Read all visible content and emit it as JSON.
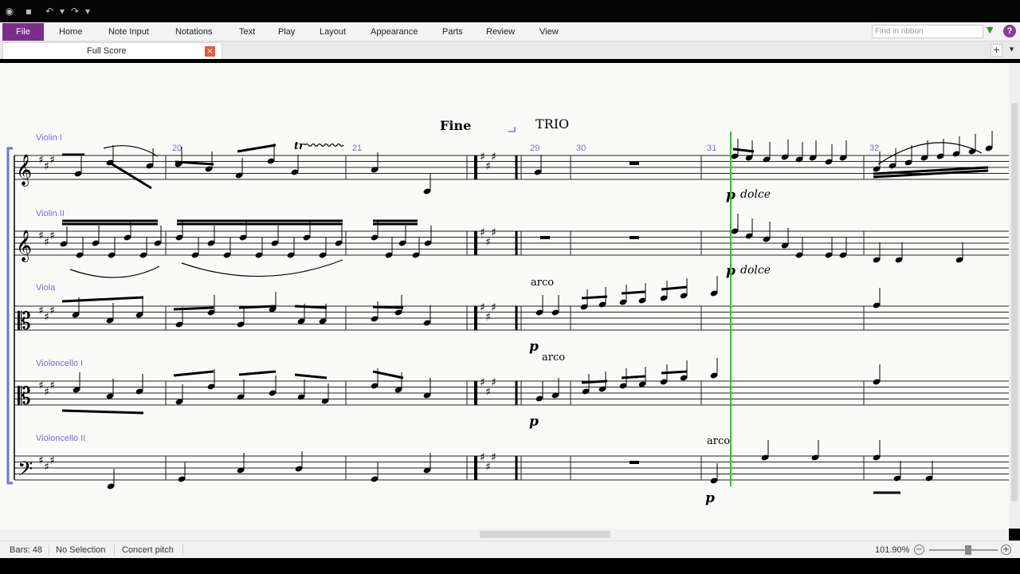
{
  "ribbon": {
    "file": "File",
    "tabs": [
      "Home",
      "Note Input",
      "Notations",
      "Text",
      "Play",
      "Layout",
      "Appearance",
      "Parts",
      "Review",
      "View"
    ],
    "find_placeholder": "Find in ribbon",
    "help": "?"
  },
  "document_tab": {
    "label": "Full Score",
    "close": "×"
  },
  "tabbar_buttons": {
    "add": "+",
    "menu": "▾"
  },
  "score": {
    "instruments": [
      "Violin I",
      "Violin II",
      "Viola",
      "Violoncello I",
      "Violoncello II"
    ],
    "bar_numbers": [
      "20",
      "21",
      "29",
      "30",
      "31",
      "32"
    ],
    "text": {
      "fine": "Fine",
      "trio": "TRIO",
      "trill": "tr",
      "arco": "arco",
      "dolce": "dolce",
      "dynamic_p": "p"
    }
  },
  "status": {
    "bars": "Bars: 48",
    "selection": "No Selection",
    "pitch": "Concert pitch",
    "zoom": "101.90%"
  },
  "icons": {
    "app": "app-icon",
    "save": "save-icon",
    "undo": "undo-icon",
    "redo": "redo-icon"
  },
  "colors": {
    "file_tab": "#7a2e8a",
    "bar_numbers": "#6e74d8",
    "instrument_names": "#6e74d8",
    "playback_line": "#22cc22",
    "close_button": "#e85a3c"
  }
}
